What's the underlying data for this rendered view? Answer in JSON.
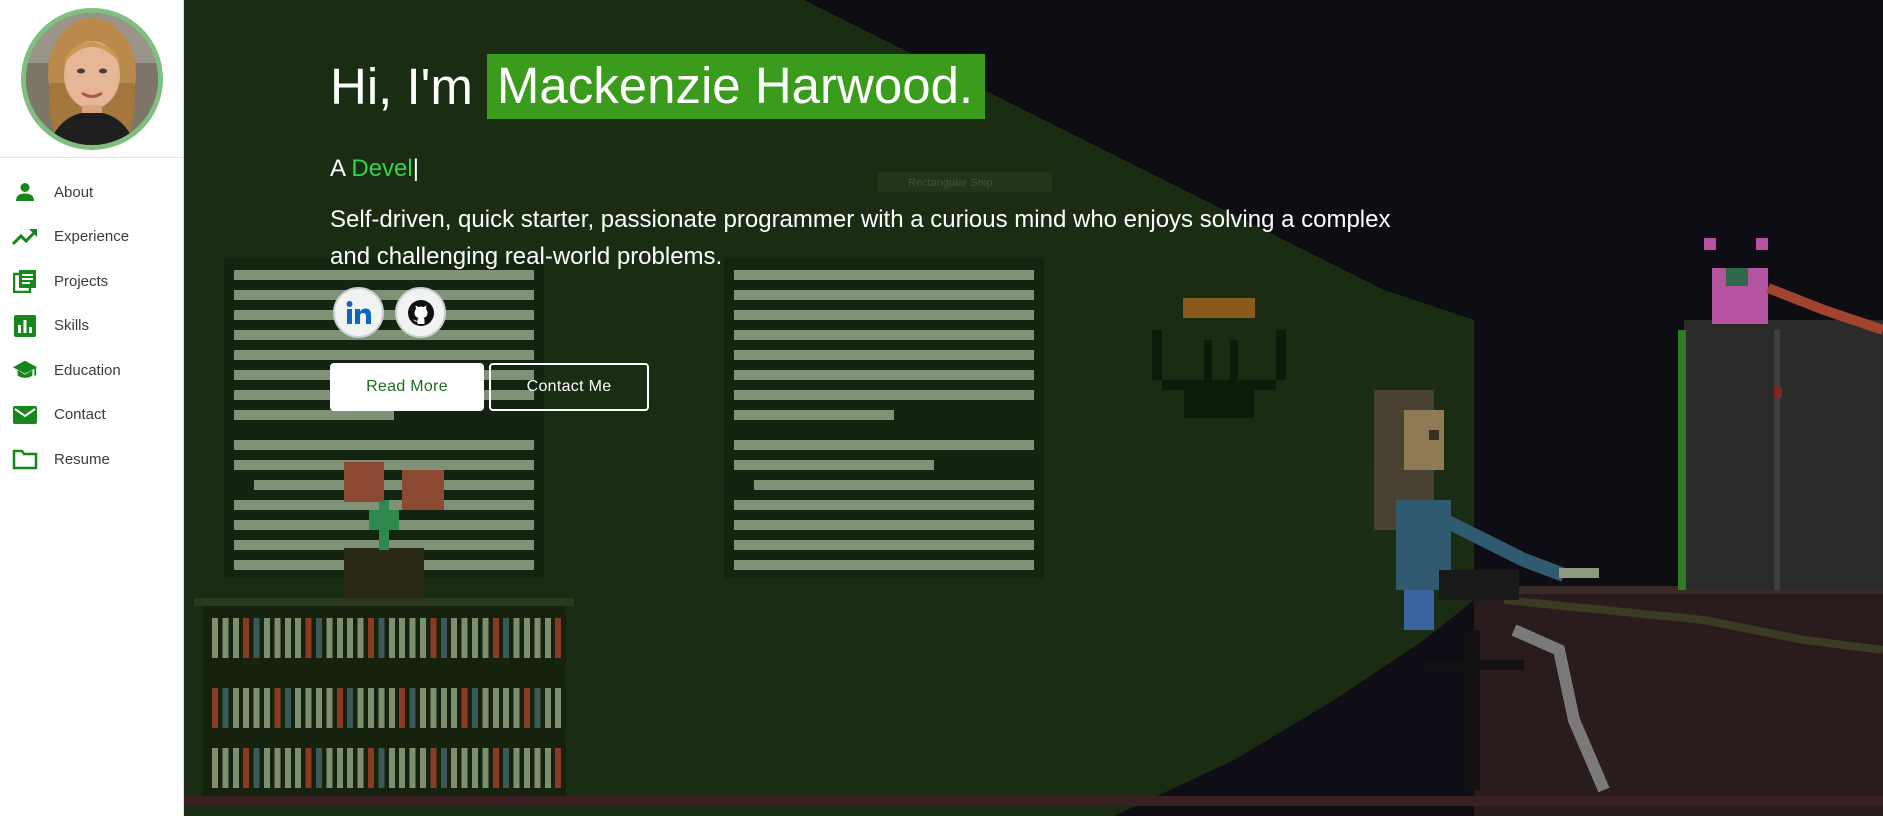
{
  "sidebar": {
    "avatar_alt": "Mackenzie Harwood portrait",
    "items": [
      {
        "label": "About",
        "icon": "person-icon"
      },
      {
        "label": "Experience",
        "icon": "trending-up-icon"
      },
      {
        "label": "Projects",
        "icon": "projects-icon"
      },
      {
        "label": "Skills",
        "icon": "bar-chart-icon"
      },
      {
        "label": "Education",
        "icon": "graduation-cap-icon"
      },
      {
        "label": "Contact",
        "icon": "mail-icon"
      },
      {
        "label": "Resume",
        "icon": "folder-icon"
      }
    ]
  },
  "hero": {
    "greeting": "Hi, I'm",
    "name": "Mackenzie Harwood.",
    "typed_prefix": "A ",
    "typed_word": "Devel",
    "cursor": "|",
    "bio": "Self-driven, quick starter, passionate programmer with a curious mind who enjoys solving a complex and challenging real-world problems.",
    "socials": [
      {
        "icon": "linkedin-icon"
      },
      {
        "icon": "github-icon"
      }
    ],
    "read_more_label": "Read More",
    "contact_label": "Contact Me",
    "scene_overlay_text": "Rectangular Snip"
  },
  "colors": {
    "accent": "#3a9b1c",
    "typed_word": "#34d44a",
    "icon_green": "#17861c",
    "sidebar_bg": "#ffffff"
  }
}
